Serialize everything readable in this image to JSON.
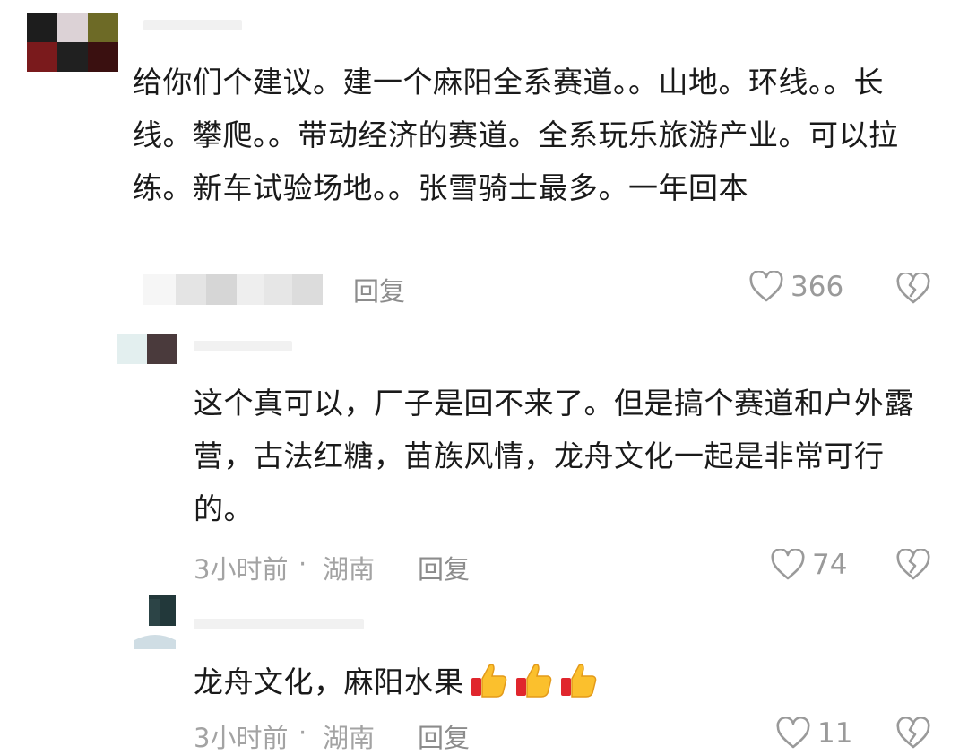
{
  "comments": [
    {
      "text": "给你们个建议。建一个麻阳全系赛道。。山地。环线。。长线。攀爬。。带动经济的赛道。全系玩乐旅游产业。可以拉练。新车试验场地。。张雪骑士最多。一年回本",
      "reply_label": "回复",
      "likes": "366",
      "avatar_icon": "blurred-avatar"
    }
  ],
  "replies": [
    {
      "text": "这个真可以，厂子是回不来了。但是搞个赛道和户外露营，古法红糖，苗族风情，龙舟文化一起是非常可行的。",
      "time": "3小时前",
      "location": "湖南",
      "reply_label": "回复",
      "likes": "74"
    },
    {
      "text": "龙舟文化，麻阳水果",
      "emojis": [
        "thumbs-up",
        "thumbs-up",
        "thumbs-up"
      ],
      "time": "3小时前",
      "location": "湖南",
      "reply_label": "回复",
      "likes": "11"
    }
  ],
  "separator": " · ",
  "icons": {
    "like": "heart-outline-icon",
    "dislike": "broken-heart-icon"
  },
  "colors": {
    "text": "#1a1a1a",
    "meta": "#a3a3a3",
    "icon": "#9a9a9a"
  }
}
